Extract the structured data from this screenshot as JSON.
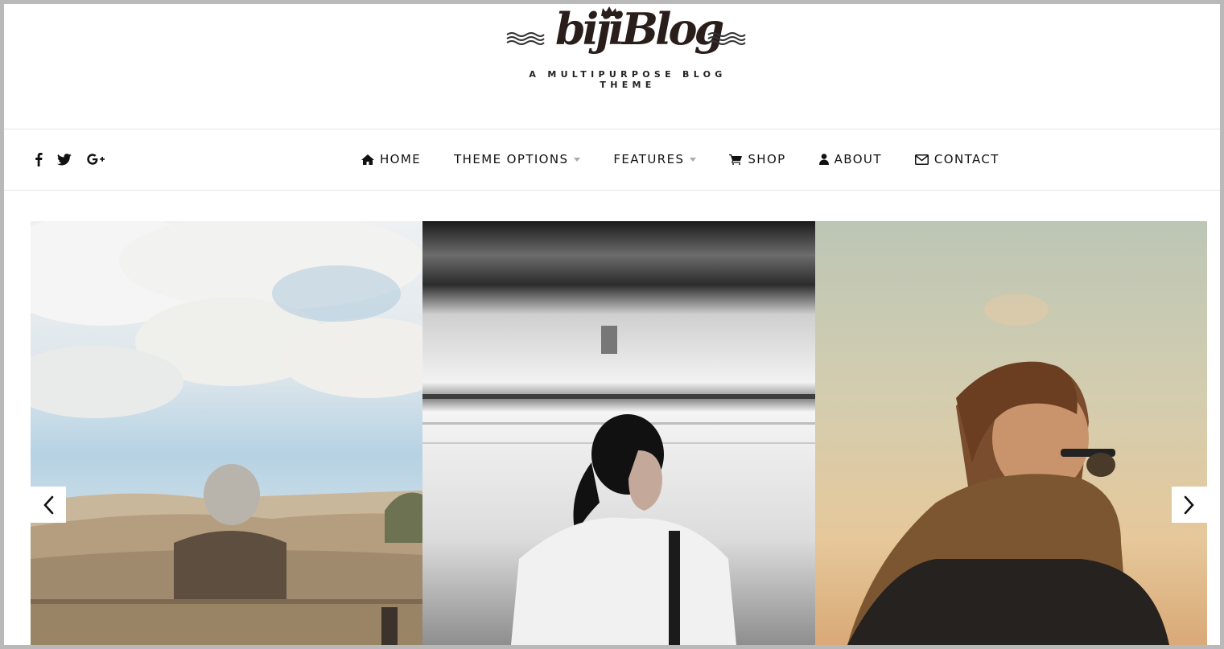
{
  "logo": {
    "script_text": "bijiBlog",
    "tagline": "A MULTIPURPOSE BLOG THEME"
  },
  "social": {
    "icons": [
      "facebook-icon",
      "twitter-icon",
      "google-plus-icon"
    ]
  },
  "nav": {
    "items": [
      {
        "label": "HOME",
        "icon": "home-icon",
        "dropdown": false
      },
      {
        "label": "THEME OPTIONS",
        "icon": null,
        "dropdown": true
      },
      {
        "label": "FEATURES",
        "icon": null,
        "dropdown": true
      },
      {
        "label": "SHOP",
        "icon": "cart-icon",
        "dropdown": false
      },
      {
        "label": "ABOUT",
        "icon": "user-icon",
        "dropdown": false
      },
      {
        "label": "CONTACT",
        "icon": "envelope-icon",
        "dropdown": false
      }
    ]
  },
  "slider": {
    "prev_icon": "chevron-left-icon",
    "next_icon": "chevron-right-icon",
    "slides": [
      {
        "subject": "elderly person sitting on bench facing dunes and cloudy sky"
      },
      {
        "subject": "woman with ponytail standing before blurred train (black and white)"
      },
      {
        "subject": "person with scarf and sunglasses looking toward sunset sky"
      }
    ]
  },
  "colors": {
    "background": "#ffffff",
    "outer_border": "#b9b9b9",
    "text": "#111111",
    "divider": "#e6e6e6",
    "caret": "#aaaaaa"
  }
}
